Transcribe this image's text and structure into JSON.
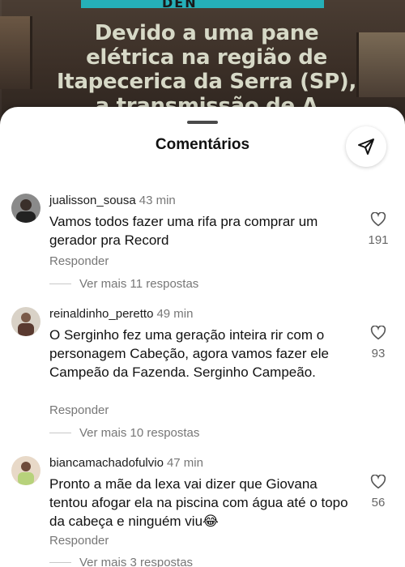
{
  "post": {
    "banner": "DEN",
    "caption": "Devido a uma pane elétrica na região de Itapecerica da Serra (SP), a transmissão de A Fazenda no RecordPlus foi"
  },
  "sheet": {
    "title": "Comentários",
    "share_icon": "send-icon"
  },
  "comments": [
    {
      "username": "jualisson_sousa",
      "time": "43 min",
      "text": "Vamos todos fazer uma rifa pra comprar um gerador pra Record",
      "likes": "191",
      "reply_label": "Responder",
      "more_replies": "Ver mais 11 respostas"
    },
    {
      "username": "reinaldinho_peretto",
      "time": "49 min",
      "text": "O Serginho fez uma geração inteira rir com o personagem Cabeção, agora vamos fazer ele Campeão da Fazenda. Serginho Campeão.",
      "likes": "93",
      "reply_label": "Responder",
      "more_replies": "Ver mais 10 respostas"
    },
    {
      "username": "biancamachadofulvio",
      "time": "47 min",
      "text": "Pronto a mãe da lexa vai dizer que Giovana tentou afogar ela na piscina com água até o topo da cabeça e ninguém viu😂",
      "likes": "56",
      "reply_label": "Responder",
      "more_replies": "Ver mais 3 respostas"
    }
  ]
}
